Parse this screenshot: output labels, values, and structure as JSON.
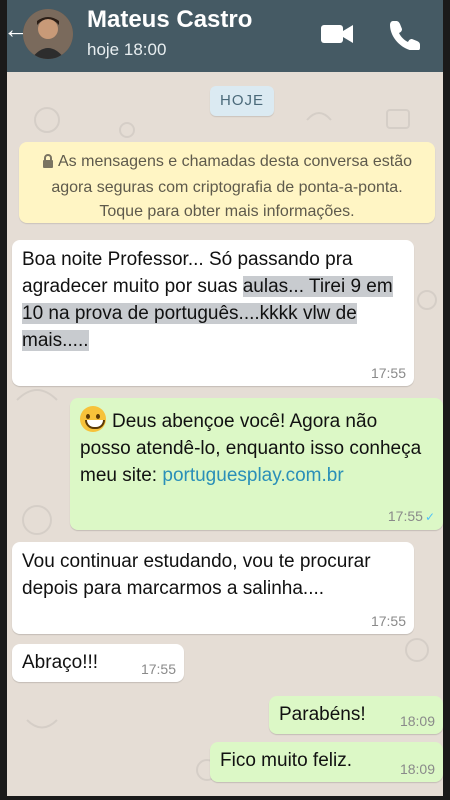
{
  "header": {
    "contact_name": "Mateus Castro",
    "status": "hoje 18:00",
    "icons": [
      "back-arrow-icon",
      "video-call-icon",
      "phone-call-icon"
    ]
  },
  "date_chip": "HOJE",
  "encryption_notice": "As mensagens e chamadas desta conversa estão agora seguras com criptografia de ponta-a-ponta. Toque para obter mais informações.",
  "messages": [
    {
      "direction": "incoming",
      "text_plain": "Boa noite Professor... Só passando pra agradecer muito por suas",
      "text_highlighted": "aulas... Tirei 9 em 10 na prova de português....kkkk vlw de mais.....",
      "time": "17:55"
    },
    {
      "direction": "outgoing",
      "emoji": "grinning-face-emoji",
      "text": "Deus abençoe você! Agora não posso atendê-lo, enquanto isso conheça meu site:",
      "link": "portuguesplay.com.br",
      "time": "17:55"
    },
    {
      "direction": "incoming",
      "text": "Vou continuar estudando, vou te procurar depois para marcarmos a salinha....",
      "time": "17:55"
    },
    {
      "direction": "incoming",
      "text": "Abraço!!!",
      "time": "17:55"
    },
    {
      "direction": "outgoing",
      "text": "Parabéns!",
      "time": "18:09"
    },
    {
      "direction": "outgoing",
      "text": "Fico muito feliz.",
      "time": "18:09"
    }
  ],
  "colors": {
    "header": "#455a64",
    "chat_background": "#e5ddd5",
    "incoming_bubble": "#ffffff",
    "outgoing_bubble": "#dcf8c6",
    "encryption_bg": "#fff5c4",
    "link": "#2a8fb8"
  }
}
